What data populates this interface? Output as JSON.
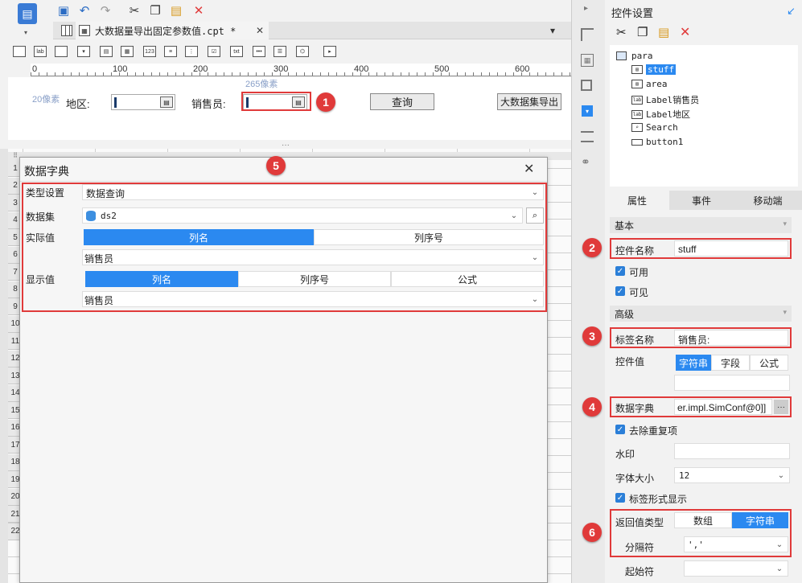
{
  "file_tab": {
    "name": "大数据量导出固定参数值.cpt *"
  },
  "ruler": {
    "ticks": [
      "0",
      "100",
      "200",
      "300",
      "400",
      "500",
      "600"
    ],
    "size_hint_w": "265像素",
    "size_hint_h": "20像素"
  },
  "form": {
    "region_label": "地区:",
    "seller_label": "销售员:",
    "query_button": "查询",
    "export_button": "大数据集导出"
  },
  "row_numbers": [
    "1",
    "2",
    "3",
    "4",
    "5",
    "6",
    "7",
    "8",
    "9",
    "10",
    "11",
    "12",
    "13",
    "14",
    "15",
    "16",
    "17",
    "18",
    "19",
    "20",
    "21",
    "22"
  ],
  "dialog": {
    "title": "数据字典",
    "type_label": "类型设置",
    "type_value": "数据查询",
    "dataset_label": "数据集",
    "dataset_value": "ds2",
    "actual_label": "实际值",
    "actual_tabs": [
      "列名",
      "列序号"
    ],
    "actual_value": "销售员",
    "display_label": "显示值",
    "display_tabs": [
      "列名",
      "列序号",
      "公式"
    ],
    "display_value": "销售员"
  },
  "right_panel": {
    "title": "控件设置",
    "tree": {
      "root": "para",
      "items": [
        "stuff",
        "area",
        "Label销售员",
        "Label地区",
        "Search",
        "button1"
      ]
    },
    "tabs": [
      "属性",
      "事件",
      "移动端"
    ],
    "section_basic": "基本",
    "widget_name_label": "控件名称",
    "widget_name_value": "stuff",
    "enabled_label": "可用",
    "visible_label": "可见",
    "section_advanced": "高级",
    "label_name_label": "标签名称",
    "label_name_value": "销售员:",
    "control_value_label": "控件值",
    "control_value_tabs": [
      "字符串",
      "字段",
      "公式"
    ],
    "data_dict_label": "数据字典",
    "data_dict_value": "er.impl.SimConf@0]]",
    "data_dict_more": "···",
    "dedupe_label": "去除重复项",
    "watermark_label": "水印",
    "font_size_label": "字体大小",
    "font_size_value": "12",
    "label_display_label": "标签形式显示",
    "return_type_label": "返回值类型",
    "return_type_tabs": [
      "数组",
      "字符串"
    ],
    "separator_label": "分隔符",
    "separator_value": "','",
    "start_label": "起始符"
  },
  "badges": [
    "1",
    "2",
    "3",
    "4",
    "5",
    "6"
  ],
  "colors": {
    "accent": "#2b89f0",
    "red": "#e03a3a"
  }
}
